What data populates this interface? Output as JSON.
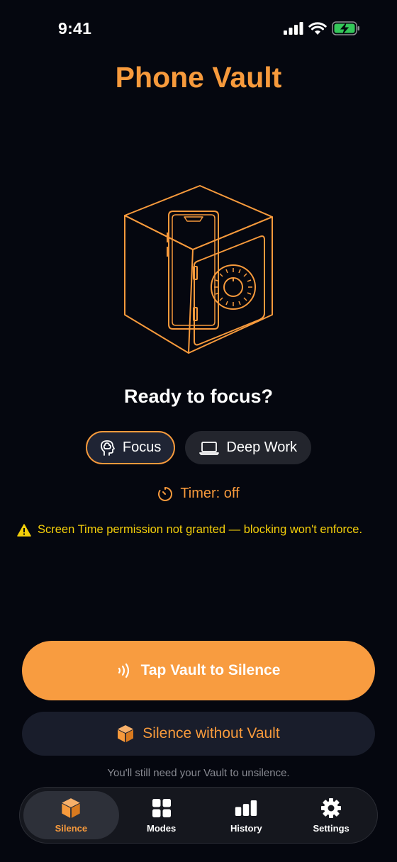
{
  "status_bar": {
    "time": "9:41"
  },
  "app": {
    "title": "Phone Vault"
  },
  "main": {
    "prompt": "Ready to focus?",
    "modes": [
      {
        "label": "Focus",
        "icon": "head-brain-icon",
        "selected": true
      },
      {
        "label": "Deep Work",
        "icon": "laptop-icon",
        "selected": false
      }
    ],
    "timer_label": "Timer: off",
    "warning_text": "Screen Time permission not granted — blocking won't enforce."
  },
  "actions": {
    "primary_label": "Tap Vault to Silence",
    "secondary_label": "Silence without Vault",
    "footnote": "You'll still need your Vault to unsilence."
  },
  "tab_bar": {
    "tabs": [
      {
        "label": "Silence",
        "icon": "cube-icon",
        "active": true
      },
      {
        "label": "Modes",
        "icon": "grid-icon",
        "active": false
      },
      {
        "label": "History",
        "icon": "bar-chart-icon",
        "active": false
      },
      {
        "label": "Settings",
        "icon": "gear-icon",
        "active": false
      }
    ]
  },
  "colors": {
    "background": "#05070f",
    "accent": "#f79a3c",
    "warning": "#f4cf0a",
    "battery": "#34c759"
  }
}
